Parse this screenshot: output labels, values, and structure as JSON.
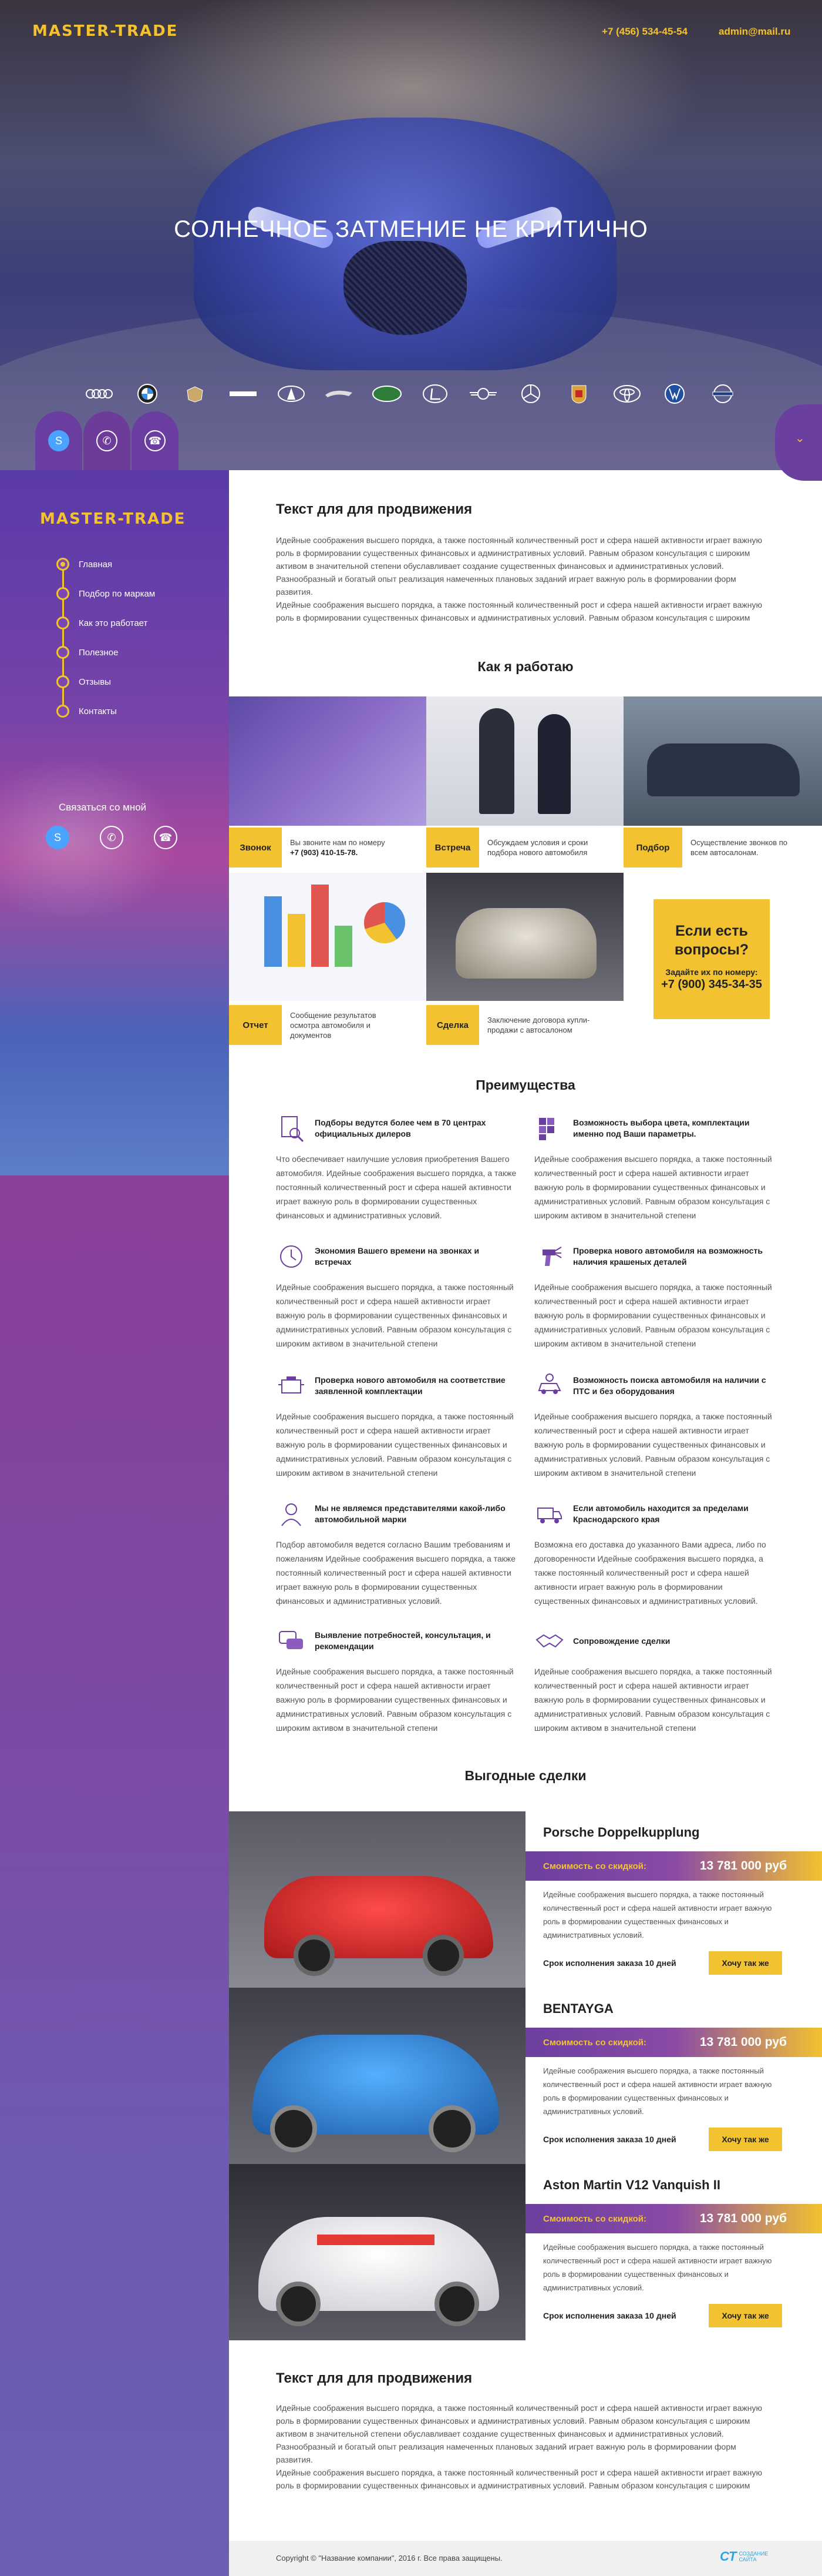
{
  "header": {
    "logo": "MASTER-TRADE",
    "phone": "+7 (456) 534-45-54",
    "email": "admin@mail.ru"
  },
  "hero": {
    "title": "СОЛНЕЧНОЕ ЗАТМЕНИЕ НЕ КРИТИЧНО",
    "brands": [
      "audi",
      "bmw",
      "cadillac",
      "hummer",
      "infiniti",
      "jaguar",
      "land-rover",
      "lexus",
      "mini",
      "mercedes",
      "porsche",
      "toyota",
      "volkswagen",
      "volvo"
    ]
  },
  "sidebar": {
    "logo": "MASTER-TRADE",
    "menu": [
      {
        "label": "Главная",
        "active": true
      },
      {
        "label": "Подбор по маркам",
        "active": false
      },
      {
        "label": "Как это работает",
        "active": false
      },
      {
        "label": "Полезное",
        "active": false
      },
      {
        "label": "Отзывы",
        "active": false
      },
      {
        "label": "Контакты",
        "active": false
      }
    ],
    "contact_title": "Связаться со мной"
  },
  "promo": {
    "title": "Текст для для продвижения",
    "lines": [
      "Идейные соображения высшего порядка, а также постоянный количественный рост и сфера нашей активности играет важную",
      "роль в формировании существенных финансовых и административных условий. Равным образом консультация с широким",
      "активом в значительной степени обуславливает создание существенных финансовых и административных условий.",
      "Разнообразный и богатый опыт реализация намеченных плановых заданий играет важную роль в формировании форм",
      "развития.",
      "Идейные соображения высшего порядка, а также постоянный количественный рост и сфера нашей активности играет важную",
      "роль в формировании существенных финансовых и административных условий. Равным образом консультация с широким"
    ]
  },
  "how": {
    "title": "Как я работаю",
    "steps": [
      {
        "tag": "Звонок",
        "text": "Вы звоните нам по номеру",
        "text2": "+7 (903) 410-15-78."
      },
      {
        "tag": "Встреча",
        "text": "Обсуждаем условия и сроки подбора нового автомобиля",
        "text2": ""
      },
      {
        "tag": "Подбор",
        "text": "Осуществление звонков по всем автосалонам.",
        "text2": ""
      },
      {
        "tag": "Отчет",
        "text": "Сообщение результатов осмотра автомобиля и документов",
        "text2": ""
      },
      {
        "tag": "Сделка",
        "text": "Заключение договора купли-продажи с автосалоном",
        "text2": ""
      }
    ],
    "questions": {
      "title": "Если есть вопросы?",
      "call": "Задайте их по номеру:",
      "phone": "+7 (900) 345-34-35"
    }
  },
  "advantages": {
    "title": "Преимущества",
    "items": [
      {
        "icon": "search-document-icon",
        "title": "Подборы ведутся более чем в 70 центрах официальных дилеров",
        "text": "Что обеспечивает наилучшие условия приобретения Вашего автомобиля. Идейные соображения высшего порядка, а также постоянный количественный рост и сфера нашей активности играет важную роль в формировании существенных финансовых и административных условий."
      },
      {
        "icon": "color-palette-icon",
        "title": "Возможность выбора цвета, комплектации именно под Ваши параметры.",
        "text": "Идейные соображения высшего порядка, а также постоянный количественный рост и сфера нашей активности играет важную роль в формировании существенных финансовых и административных условий. Равным образом консультация с широким активом в значительной степени"
      },
      {
        "icon": "clock-icon",
        "title": "Экономия Вашего времени на звонках и встречах",
        "text": "Идейные соображения высшего порядка, а также постоянный количественный рост и сфера нашей активности играет важную роль в формировании существенных финансовых и административных условий. Равным образом консультация с широким активом в значительной степени"
      },
      {
        "icon": "spray-gun-icon",
        "title": "Проверка нового автомобиля на возможность наличия крашеных деталей",
        "text": "Идейные соображения высшего порядка, а также постоянный количественный рост и сфера нашей активности играет важную роль в формировании существенных финансовых и административных условий. Равным образом консультация с широким активом в значительной степени"
      },
      {
        "icon": "engine-icon",
        "title": "Проверка нового автомобиля на соответствие заявленной комплектации",
        "text": "Идейные соображения высшего порядка, а также постоянный количественный рост и сфера нашей активности играет важную роль в формировании существенных финансовых и административных условий. Равным образом консультация с широким активом в значительной степени"
      },
      {
        "icon": "car-search-icon",
        "title": "Возможность поиска автомобиля на наличии с ПТС и без оборудования",
        "text": "Идейные соображения высшего порядка, а также постоянный количественный рост и сфера нашей активности играет важную роль в формировании существенных финансовых и административных условий. Равным образом консультация с широким активом в значительной степени"
      },
      {
        "icon": "user-icon",
        "title": "Мы не являемся представителями какой-либо автомобильной марки",
        "text": "Подбор автомобиля ведется согласно Вашим требованиям и пожеланиям Идейные соображения высшего порядка, а также постоянный количественный рост и сфера нашей активности играет важную роль в формировании существенных финансовых и административных условий."
      },
      {
        "icon": "truck-icon",
        "title": "Если автомобиль находится за пределами Краснодарского края",
        "text": "Возможна его доставка до указанного Вами адреса, либо по договоренности Идейные соображения высшего порядка, а также постоянный количественный рост и сфера нашей активности играет важную роль в формировании существенных финансовых и административных условий."
      },
      {
        "icon": "chat-icon",
        "title": "Выявление потребностей, консультация, и рекомендации",
        "text": "Идейные соображения высшего порядка, а также постоянный количественный рост и сфера нашей активности играет важную роль в формировании существенных финансовых и административных условий. Равным образом консультация с широким активом в значительной степени"
      },
      {
        "icon": "handshake-icon",
        "title": "Сопровождение сделки",
        "text": "Идейные соображения высшего порядка, а также постоянный количественный рост и сфера нашей активности играет важную роль в формировании существенных финансовых и административных условий. Равным образом консультация с широким активом в значительной степени"
      }
    ]
  },
  "deals": {
    "title": "Выгодные сделки",
    "items": [
      {
        "name": "Porsche Doppelkupplung",
        "price_label": "Смоимость со скидкой:",
        "price": "13 781 000 руб",
        "text": "Идейные соображения высшего порядка, а также постоянный количественный рост и сфера нашей активности играет важную роль в формировании существенных финансовых и административных условий.",
        "term": "Срок исполнения заказа  10 дней",
        "button": "Хочу так же",
        "color": "#d0262e"
      },
      {
        "name": "BENTAYGA",
        "price_label": "Смоимость со скидкой:",
        "price": "13 781 000 руб",
        "text": "Идейные соображения высшего порядка, а также постоянный количественный рост и сфера нашей активности играет важную роль в формировании существенных финансовых и административных условий.",
        "term": "Срок исполнения заказа  10 дней",
        "button": "Хочу так же",
        "color": "#2c7fd0"
      },
      {
        "name": "Aston Martin V12 Vanquish II",
        "price_label": "Смоимость со скидкой:",
        "price": "13 781 000 руб",
        "text": "Идейные соображения высшего порядка, а также постоянный количественный рост и сфера нашей активности играет важную роль в формировании существенных финансовых и административных условий.",
        "term": "Срок исполнения заказа  10 дней",
        "button": "Хочу так же",
        "color": "#f0f0f0"
      }
    ]
  },
  "promo2": {
    "title": "Текст для для продвижения",
    "lines": [
      "Идейные соображения высшего порядка, а также постоянный количественный рост и сфера нашей активности играет важную",
      "роль в формировании существенных финансовых и административных условий. Равным образом консультация с широким",
      "активом в значительной степени обуславливает создание существенных финансовых и административных условий.",
      "Разнообразный и богатый опыт реализация намеченных плановых заданий играет важную роль в формировании форм",
      "развития.",
      "Идейные соображения высшего порядка, а также постоянный количественный рост и сфера нашей активности играет важную",
      "роль в формировании существенных финансовых и административных условий. Равным образом консультация с широким"
    ]
  },
  "footer": {
    "copyright": "Copyright © \"Название компании\", 2016 г. Все права защищены.",
    "dev_mark": "СТ",
    "dev_text1": "СОЗДАНИЕ",
    "dev_text2": "САЙТА"
  },
  "colors": {
    "accent": "#f2c230",
    "purple": "#6b3fa0"
  }
}
